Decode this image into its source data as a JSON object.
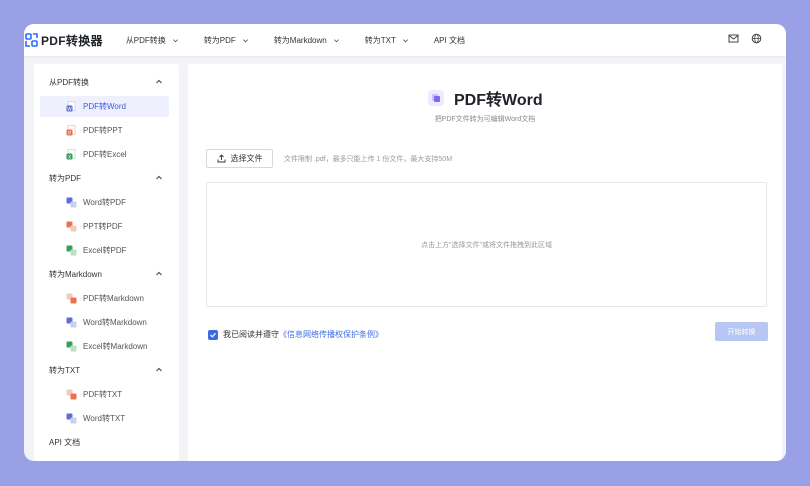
{
  "app": {
    "logo_text": "PDF转换器",
    "nav": [
      {
        "label": "从PDF转换"
      },
      {
        "label": "转为PDF"
      },
      {
        "label": "转为Markdown"
      },
      {
        "label": "转为TXT"
      },
      {
        "label": "API 文档"
      }
    ],
    "top_icons": [
      "mail-icon",
      "globe-icon"
    ]
  },
  "sidebar": {
    "groups": [
      {
        "label": "从PDF转换",
        "items": [
          {
            "label": "PDF转Word",
            "icon": "word-file-icon",
            "color": "#5b6fd6",
            "active": true
          },
          {
            "label": "PDF转PPT",
            "icon": "ppt-file-icon",
            "color": "#e8734f"
          },
          {
            "label": "PDF转Excel",
            "icon": "excel-file-icon",
            "color": "#3a9b5a"
          }
        ]
      },
      {
        "label": "转为PDF",
        "items": [
          {
            "label": "Word转PDF",
            "icon": "word-to-pdf-icon",
            "color": "#5b6fd6"
          },
          {
            "label": "PPT转PDF",
            "icon": "ppt-to-pdf-icon",
            "color": "#e8734f"
          },
          {
            "label": "Excel转PDF",
            "icon": "excel-to-pdf-icon",
            "color": "#3a9b5a"
          }
        ]
      },
      {
        "label": "转为Markdown",
        "items": [
          {
            "label": "PDF转Markdown",
            "icon": "pdf-to-md-icon",
            "color": "#e8734f"
          },
          {
            "label": "Word转Markdown",
            "icon": "word-to-md-icon",
            "color": "#5b6fd6"
          },
          {
            "label": "Excel转Markdown",
            "icon": "excel-to-md-icon",
            "color": "#3a9b5a"
          }
        ]
      },
      {
        "label": "转为TXT",
        "items": [
          {
            "label": "PDF转TXT",
            "icon": "pdf-to-txt-icon",
            "color": "#e8734f"
          },
          {
            "label": "Word转TXT",
            "icon": "word-to-txt-icon",
            "color": "#5b6fd6"
          }
        ]
      }
    ],
    "api_doc": "API 文档"
  },
  "main": {
    "title": "PDF转Word",
    "subtitle": "把PDF文件转为可编辑Word文档",
    "choose_button": "选择文件",
    "limit_text": "文件限制 .pdf，最多只能上传 1 份文件，最大支持50M",
    "dropzone_text": "点击上方\"选择文件\"或将文件拖拽到此区域",
    "agree_prefix": "我已阅读并遵守",
    "agree_link": "《信息网络传播权保护条例》",
    "start_button": "开始转换"
  },
  "colors": {
    "accent": "#3b6de0",
    "active_bg": "#eef1fd",
    "start_disabled": "#b7c6f3",
    "background": "#9aa0e6"
  }
}
